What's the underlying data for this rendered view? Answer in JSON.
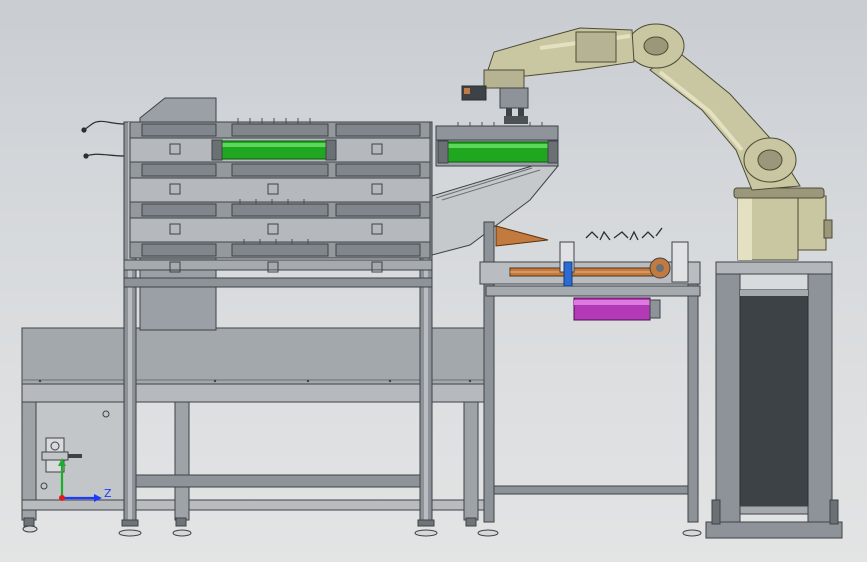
{
  "view": {
    "axis_triad": {
      "z_label": "Z"
    }
  },
  "colors": {
    "frame": "#8d9398",
    "frame_dark": "#4c5156",
    "frame_light": "#b9bdc1",
    "plate": "#a7abb0",
    "tray": "#8e9499",
    "green_roller": "#1fa81f",
    "magenta_motor": "#b23ab6",
    "robot_body": "#c9c6a2",
    "robot_shadow": "#9a977a",
    "orange_plate": "#c27a3e",
    "axis_x": "#e01b1b",
    "axis_y": "#1cae2b",
    "axis_z": "#1a3cff"
  }
}
